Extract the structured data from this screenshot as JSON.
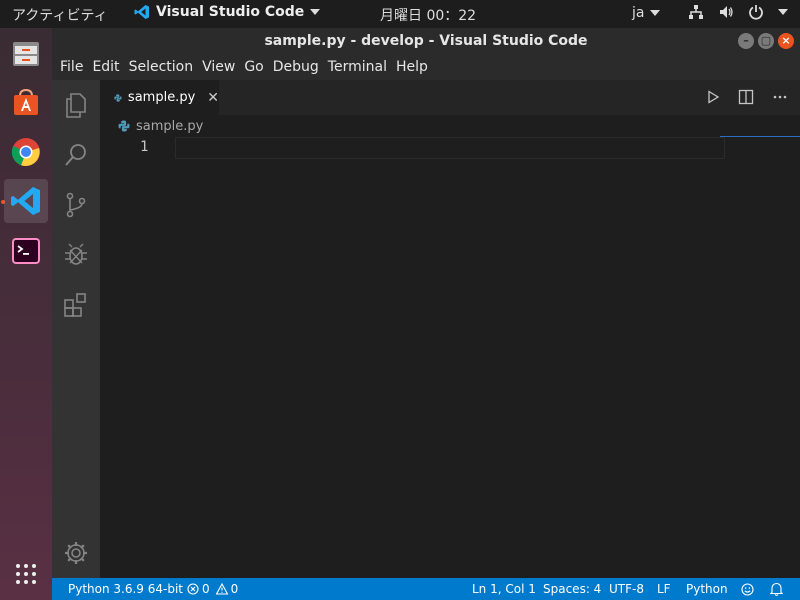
{
  "topbar": {
    "activities": "アクティビティ",
    "app_name": "Visual Studio Code",
    "clock": "月曜日 00：22",
    "lang": "ja"
  },
  "window": {
    "title": "sample.py - develop - Visual Studio Code"
  },
  "menu": [
    "File",
    "Edit",
    "Selection",
    "View",
    "Go",
    "Debug",
    "Terminal",
    "Help"
  ],
  "editor": {
    "tab_label": "sample.py",
    "breadcrumb": "sample.py",
    "line_numbers": [
      "1"
    ]
  },
  "statusbar": {
    "interpreter": "Python 3.6.9 64-bit",
    "errors": "0",
    "warnings": "0",
    "position": "Ln 1, Col 1",
    "spaces": "Spaces: 4",
    "encoding": "UTF-8",
    "eol": "LF",
    "language": "Python"
  },
  "colors": {
    "accent": "#007acc",
    "ubuntu_orange": "#e95420",
    "vscode_blue": "#23a9f2"
  }
}
